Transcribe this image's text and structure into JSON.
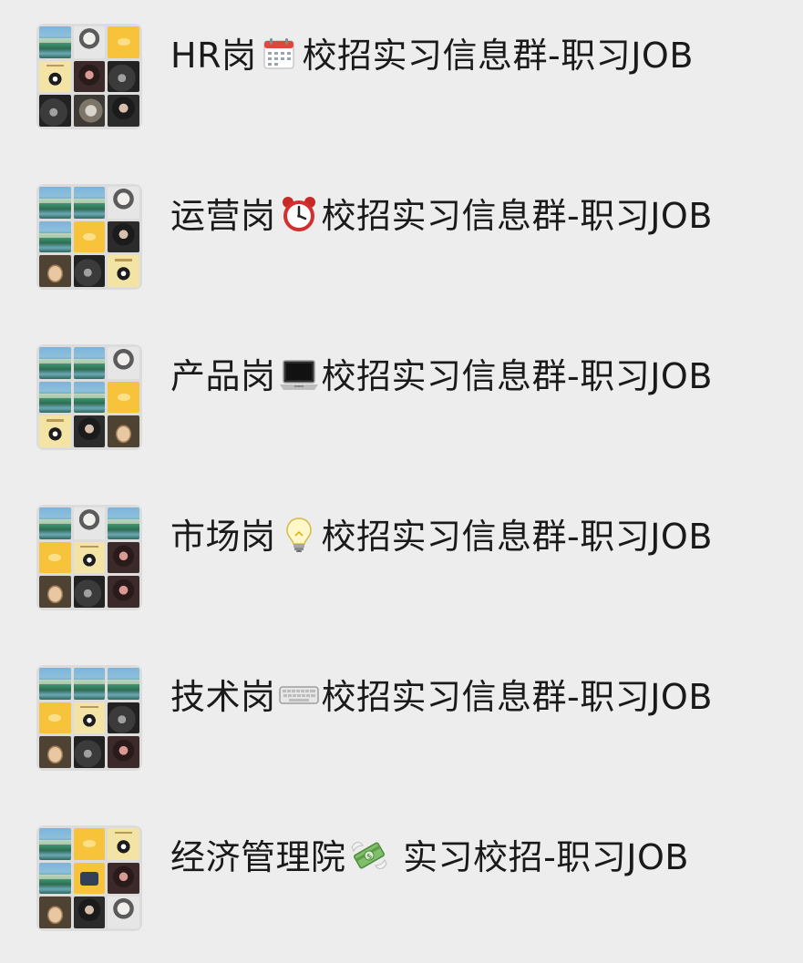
{
  "chats": [
    {
      "prefix": "HR岗",
      "emoji": "calendar-icon",
      "suffix": "校招实习信息群-职习JOB",
      "avatar_tiles": [
        "t-lake",
        "t-bw",
        "t-yellow",
        "t-cartoon",
        "t-girl",
        "t-dark",
        "t-dark",
        "t-cat",
        "t-portrait"
      ]
    },
    {
      "prefix": "运营岗",
      "emoji": "alarm-clock-icon",
      "suffix": "校招实习信息群-职习JOB",
      "avatar_tiles": [
        "t-lake",
        "t-lake",
        "t-bw",
        "t-lake",
        "t-yellow",
        "t-portrait",
        "t-potato",
        "t-dark",
        "t-cartoon"
      ]
    },
    {
      "prefix": "产品岗",
      "emoji": "laptop-icon",
      "suffix": "校招实习信息群-职习JOB",
      "avatar_tiles": [
        "t-lake",
        "t-lake",
        "t-bw",
        "t-lake",
        "t-lake",
        "t-yellow",
        "t-cartoon",
        "t-portrait",
        "t-potato"
      ]
    },
    {
      "prefix": "市场岗",
      "emoji": "light-bulb-icon",
      "suffix": "校招实习信息群-职习JOB",
      "avatar_tiles": [
        "t-lake",
        "t-bw",
        "t-lake",
        "t-yellow",
        "t-cartoon",
        "t-girl",
        "t-potato",
        "t-dark",
        "t-girl"
      ]
    },
    {
      "prefix": "技术岗",
      "emoji": "keyboard-icon",
      "suffix": "校招实习信息群-职习JOB",
      "avatar_tiles": [
        "t-lake",
        "t-lake",
        "t-lake",
        "t-yellow",
        "t-cartoon",
        "t-dark",
        "t-potato",
        "t-dark",
        "t-girl"
      ]
    },
    {
      "prefix": "经济管理院",
      "emoji": "money-with-wings-icon",
      "suffix": " 实习校招-职习JOB",
      "avatar_tiles": [
        "t-lake",
        "t-yellow",
        "t-cartoon",
        "t-lake",
        "t-house",
        "t-girl",
        "t-potato",
        "t-portrait",
        "t-bw"
      ]
    }
  ]
}
